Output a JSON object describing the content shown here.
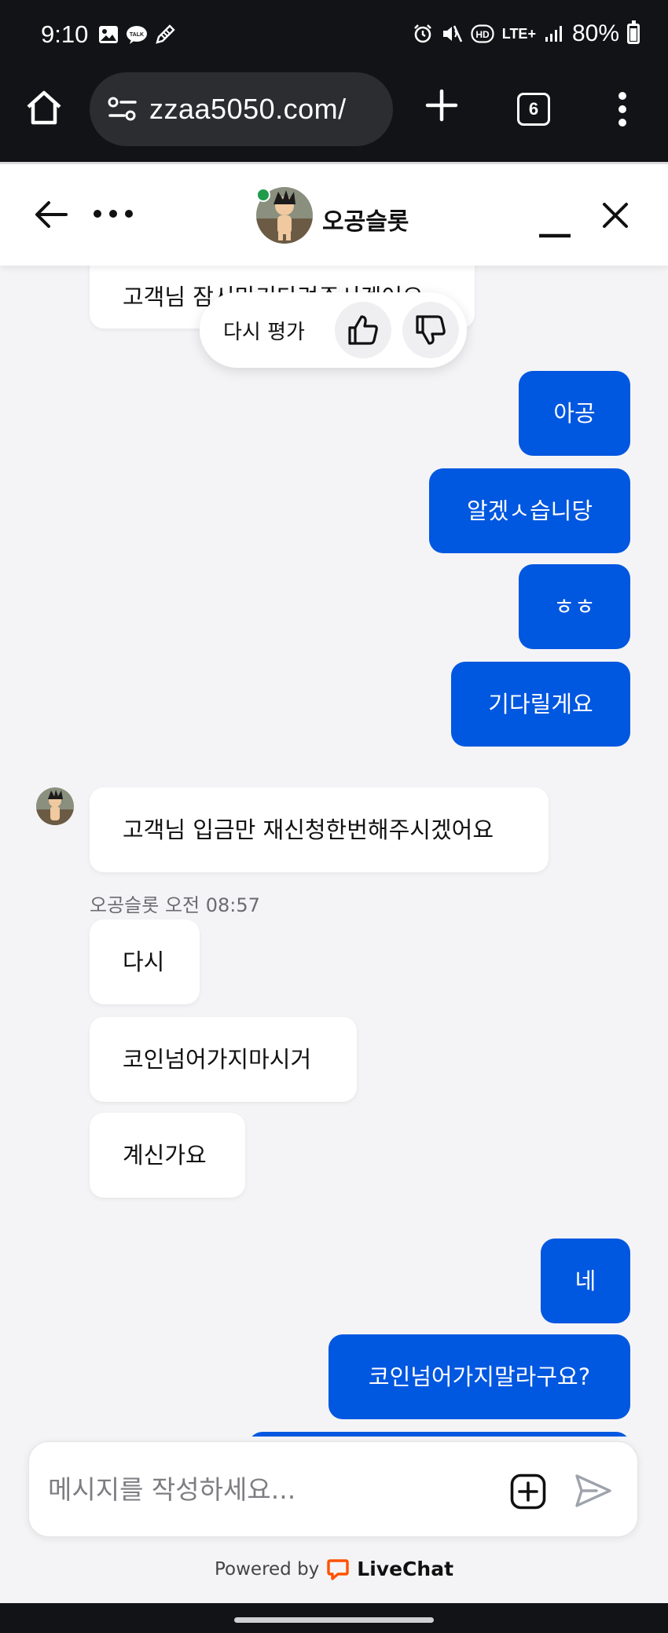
{
  "status_bar": {
    "time": "9:10",
    "left_icons": [
      "image-icon",
      "talk-icon",
      "pen-icon"
    ],
    "network": "LTE+",
    "battery": "80%"
  },
  "browser": {
    "url": "zzaa5050.com/",
    "tab_count": "6"
  },
  "chat_header": {
    "agent_name": "오공슬롯",
    "online": true
  },
  "rating": {
    "label": "다시 평가"
  },
  "messages": {
    "top_partial": "고객님 잠시만기다려주시겠어요",
    "user_group_1": [
      "아공",
      "알겠ㅅ습니당",
      "ㅎㅎ",
      "기다릴게요"
    ],
    "agent_first": "고객님 입금만 재신청한번해주시겠어요",
    "agent_meta_name": "오공슬롯",
    "agent_meta_time": "오전 08:57",
    "agent_group": [
      "다시",
      "코인넘어가지마시거",
      "계신가요"
    ],
    "user_group_2": [
      "네",
      "코인넘어가지말라구요?"
    ]
  },
  "composer": {
    "placeholder": "메시지를 작성하세요..."
  },
  "footer": {
    "powered_by": "Powered by",
    "brand": "LiveChat"
  },
  "colors": {
    "user_bubble": "#0057e0",
    "agent_bubble": "#ffffff",
    "background": "#f4f4f6",
    "online": "#1f9b4a",
    "livechat_orange": "#ff5100"
  }
}
